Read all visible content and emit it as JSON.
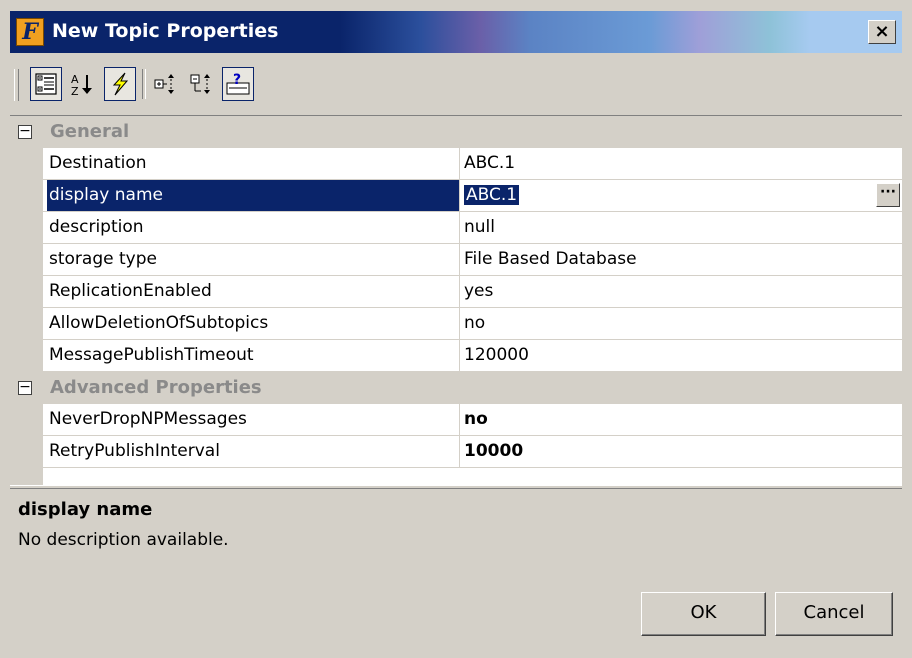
{
  "window": {
    "title": "New Topic Properties",
    "app_icon_letter": "F",
    "close_label": "×"
  },
  "toolbar": {
    "buttons": [
      "categorized-view",
      "alphabetical-sort",
      "properties",
      "expand-all",
      "collapse-all",
      "property-pages"
    ]
  },
  "grid": {
    "categories": [
      {
        "label": "General",
        "toggle": "−",
        "properties": [
          {
            "name": "Destination",
            "value": "ABC.1"
          },
          {
            "name": "display name",
            "value": "ABC.1"
          },
          {
            "name": "description",
            "value": "null"
          },
          {
            "name": "storage type",
            "value": "File Based Database"
          },
          {
            "name": "ReplicationEnabled",
            "value": "yes"
          },
          {
            "name": "AllowDeletionOfSubtopics",
            "value": "no"
          },
          {
            "name": "MessagePublishTimeout",
            "value": "120000"
          }
        ]
      },
      {
        "label": "Advanced Properties",
        "toggle": "−",
        "properties": [
          {
            "name": "NeverDropNPMessages",
            "value": "no"
          },
          {
            "name": "RetryPublishInterval",
            "value": "10000"
          }
        ]
      }
    ],
    "ellipsis_label": "···"
  },
  "description_pane": {
    "title": "display name",
    "text": "No description available."
  },
  "buttons": {
    "ok_label": "OK",
    "cancel_label": "Cancel"
  },
  "colors": {
    "selection": "#0a246a",
    "dialog_face": "#d4d0c8",
    "category_text": "#8a8a8a"
  }
}
